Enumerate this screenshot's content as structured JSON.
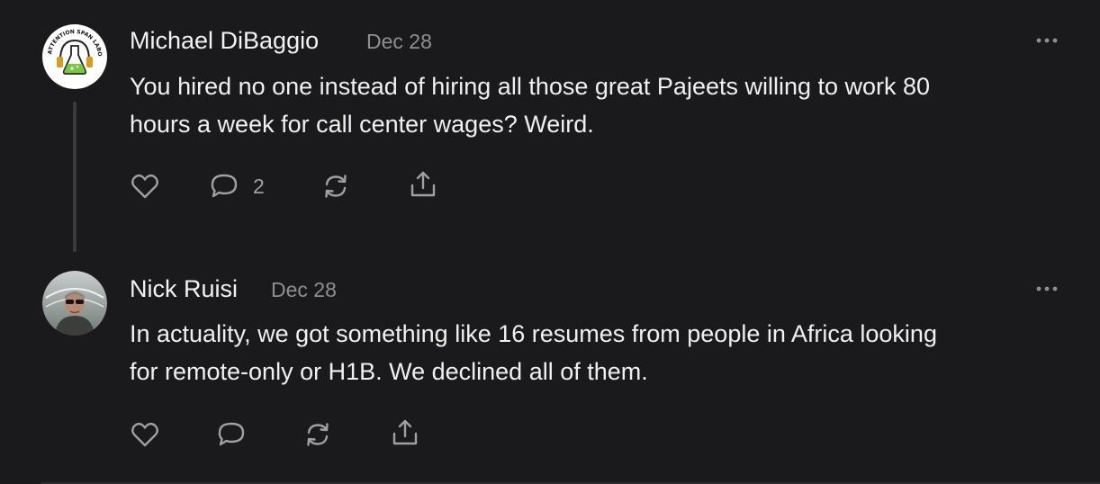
{
  "comments": [
    {
      "author": "Michael DiBaggio",
      "date": "Dec 28",
      "text_line1": "You hired no one instead of hiring all those great Pajeets willing to work 80",
      "text_line2": "hours a week for call center wages? Weird.",
      "reply_count": "2",
      "avatar": "attention-span-laboratories-logo",
      "avatar_text": "ATTENTION SPAN LABORATORIES"
    },
    {
      "author": "Nick Ruisi",
      "date": "Dec 28",
      "text_line1": "In actuality, we got something like 16 resumes from people in Africa looking",
      "text_line2": "for remote-only or H1B. We declined all of them.",
      "avatar": "profile-photo"
    }
  ],
  "icons": [
    "heart-icon",
    "comment-icon",
    "restack-icon",
    "share-icon",
    "more-icon"
  ],
  "colors": {
    "background": "#1a1a1c",
    "text": "#f0f0f0",
    "muted": "#8e8e93",
    "icon": "#a0a0a4",
    "thread_line": "#3a3a3c"
  }
}
